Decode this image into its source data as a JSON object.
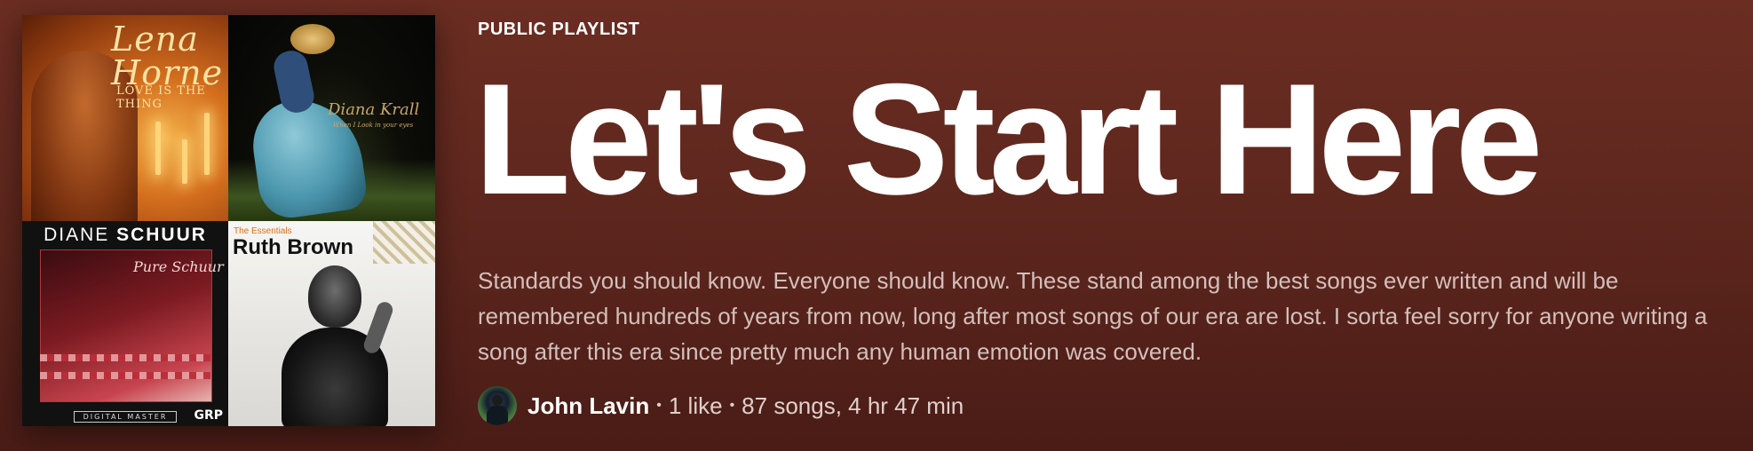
{
  "playlist": {
    "type_label": "PUBLIC PLAYLIST",
    "title": "Let's Start Here",
    "description": "Standards you should know. Everyone should know. These stand among the best songs ever written and will be remembered hundreds of years from now, long after most songs of our era are lost. I sorta feel sorry for anyone writing a song after this era since pretty much any human emotion was covered.",
    "owner": "John Lavin",
    "separator": "•",
    "likes": "1 like",
    "song_summary": "87 songs, 4 hr 47 min"
  },
  "cover": {
    "tiles": [
      {
        "artist": "Lena Horne",
        "album": "LOVE IS THE THING"
      },
      {
        "artist": "Diana Krall",
        "album": "When I Look in your eyes"
      },
      {
        "artist_first": "DIANE",
        "artist_last": "SCHUUR",
        "album": "Pure Schuur",
        "footer": "DIGITAL MASTER",
        "logo": "GRP"
      },
      {
        "pretitle": "The Essentials",
        "artist": "Ruth Brown"
      }
    ]
  },
  "colors": {
    "background": "#5e271e",
    "text_primary": "#ffffff",
    "text_secondary": "#d3bfbb"
  }
}
